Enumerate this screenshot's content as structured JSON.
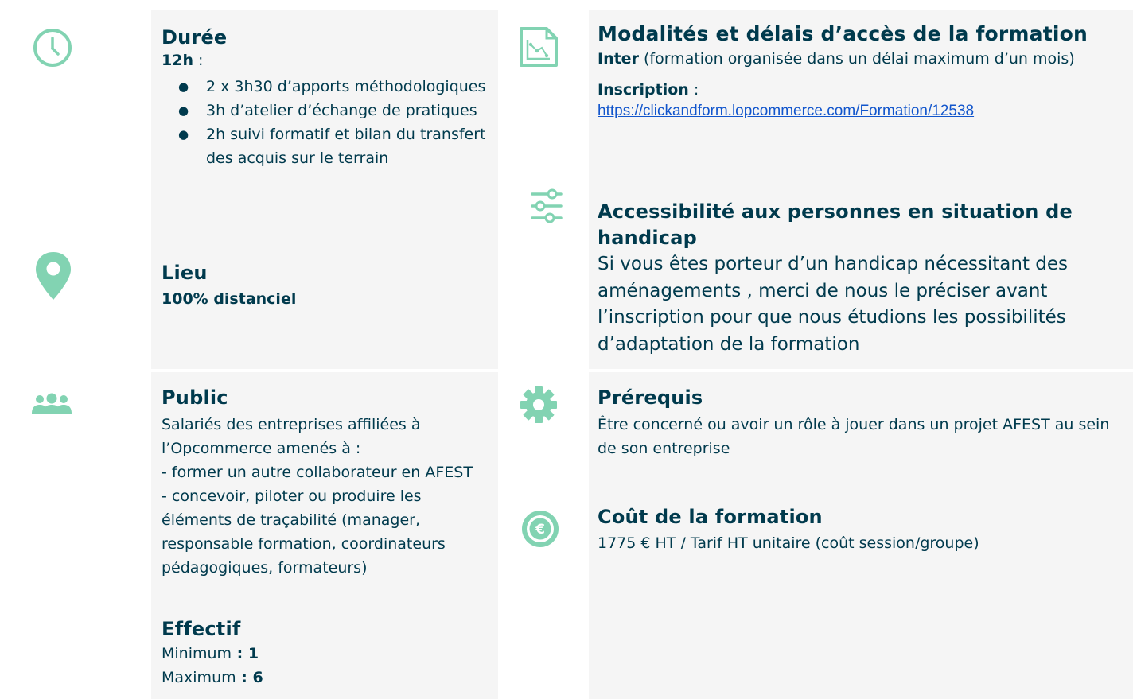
{
  "accent": "#82d3b2",
  "text_color": "#003a4d",
  "left": {
    "duree": {
      "title": "Durée",
      "hours": "12h",
      "hours_sep": " :",
      "items": [
        {
          "bullet": "●",
          "text": "2 x 3h30 d’apports méthodologiques"
        },
        {
          "bullet": "●",
          "text": "3h d’atelier d’échange de pratiques"
        },
        {
          "bullet": "●",
          "text": "2h suivi formatif et bilan du transfert des acquis sur le terrain"
        }
      ]
    },
    "lieu": {
      "title": "Lieu",
      "value": "100% distanciel"
    },
    "public": {
      "title": "Public",
      "lines": [
        "Salariés des entreprises affiliées à l’Opcommerce amenés à :",
        "- former un autre collaborateur en AFEST",
        "- concevoir, piloter ou produire les éléments de traçabilité (manager, responsable formation, coordinateurs pédagogiques, formateurs)"
      ]
    },
    "effectif": {
      "title": "Effectif",
      "min_label": "Minimum",
      "min_value": " : 1",
      "max_label": "Maximum",
      "max_value": " : 6"
    }
  },
  "right": {
    "modalites": {
      "title": "Modalités et délais d’accès de la formation",
      "inter_label": "Inter",
      "inter_text": " (formation organisée dans un délai maximum d’un mois)",
      "inscription_label": "Inscription",
      "inscription_sep": " :",
      "inscription_link": "https://clickandform.lopcommerce.com/Formation/12538"
    },
    "accessibilite": {
      "title": "Accessibilité aux personnes en situation de handicap",
      "text": "Si vous êtes porteur d’un handicap nécessitant des aménagements , merci de nous le préciser avant l’inscription pour que nous étudions les possibilités d’adaptation de la formation"
    },
    "prerequis": {
      "title": "Prérequis",
      "text": "Être concerné ou avoir un rôle à jouer dans un projet AFEST au sein de son entreprise"
    },
    "cout": {
      "title": "Coût de la formation",
      "text": "1775 € HT / Tarif HT unitaire (coût session/groupe)"
    }
  }
}
